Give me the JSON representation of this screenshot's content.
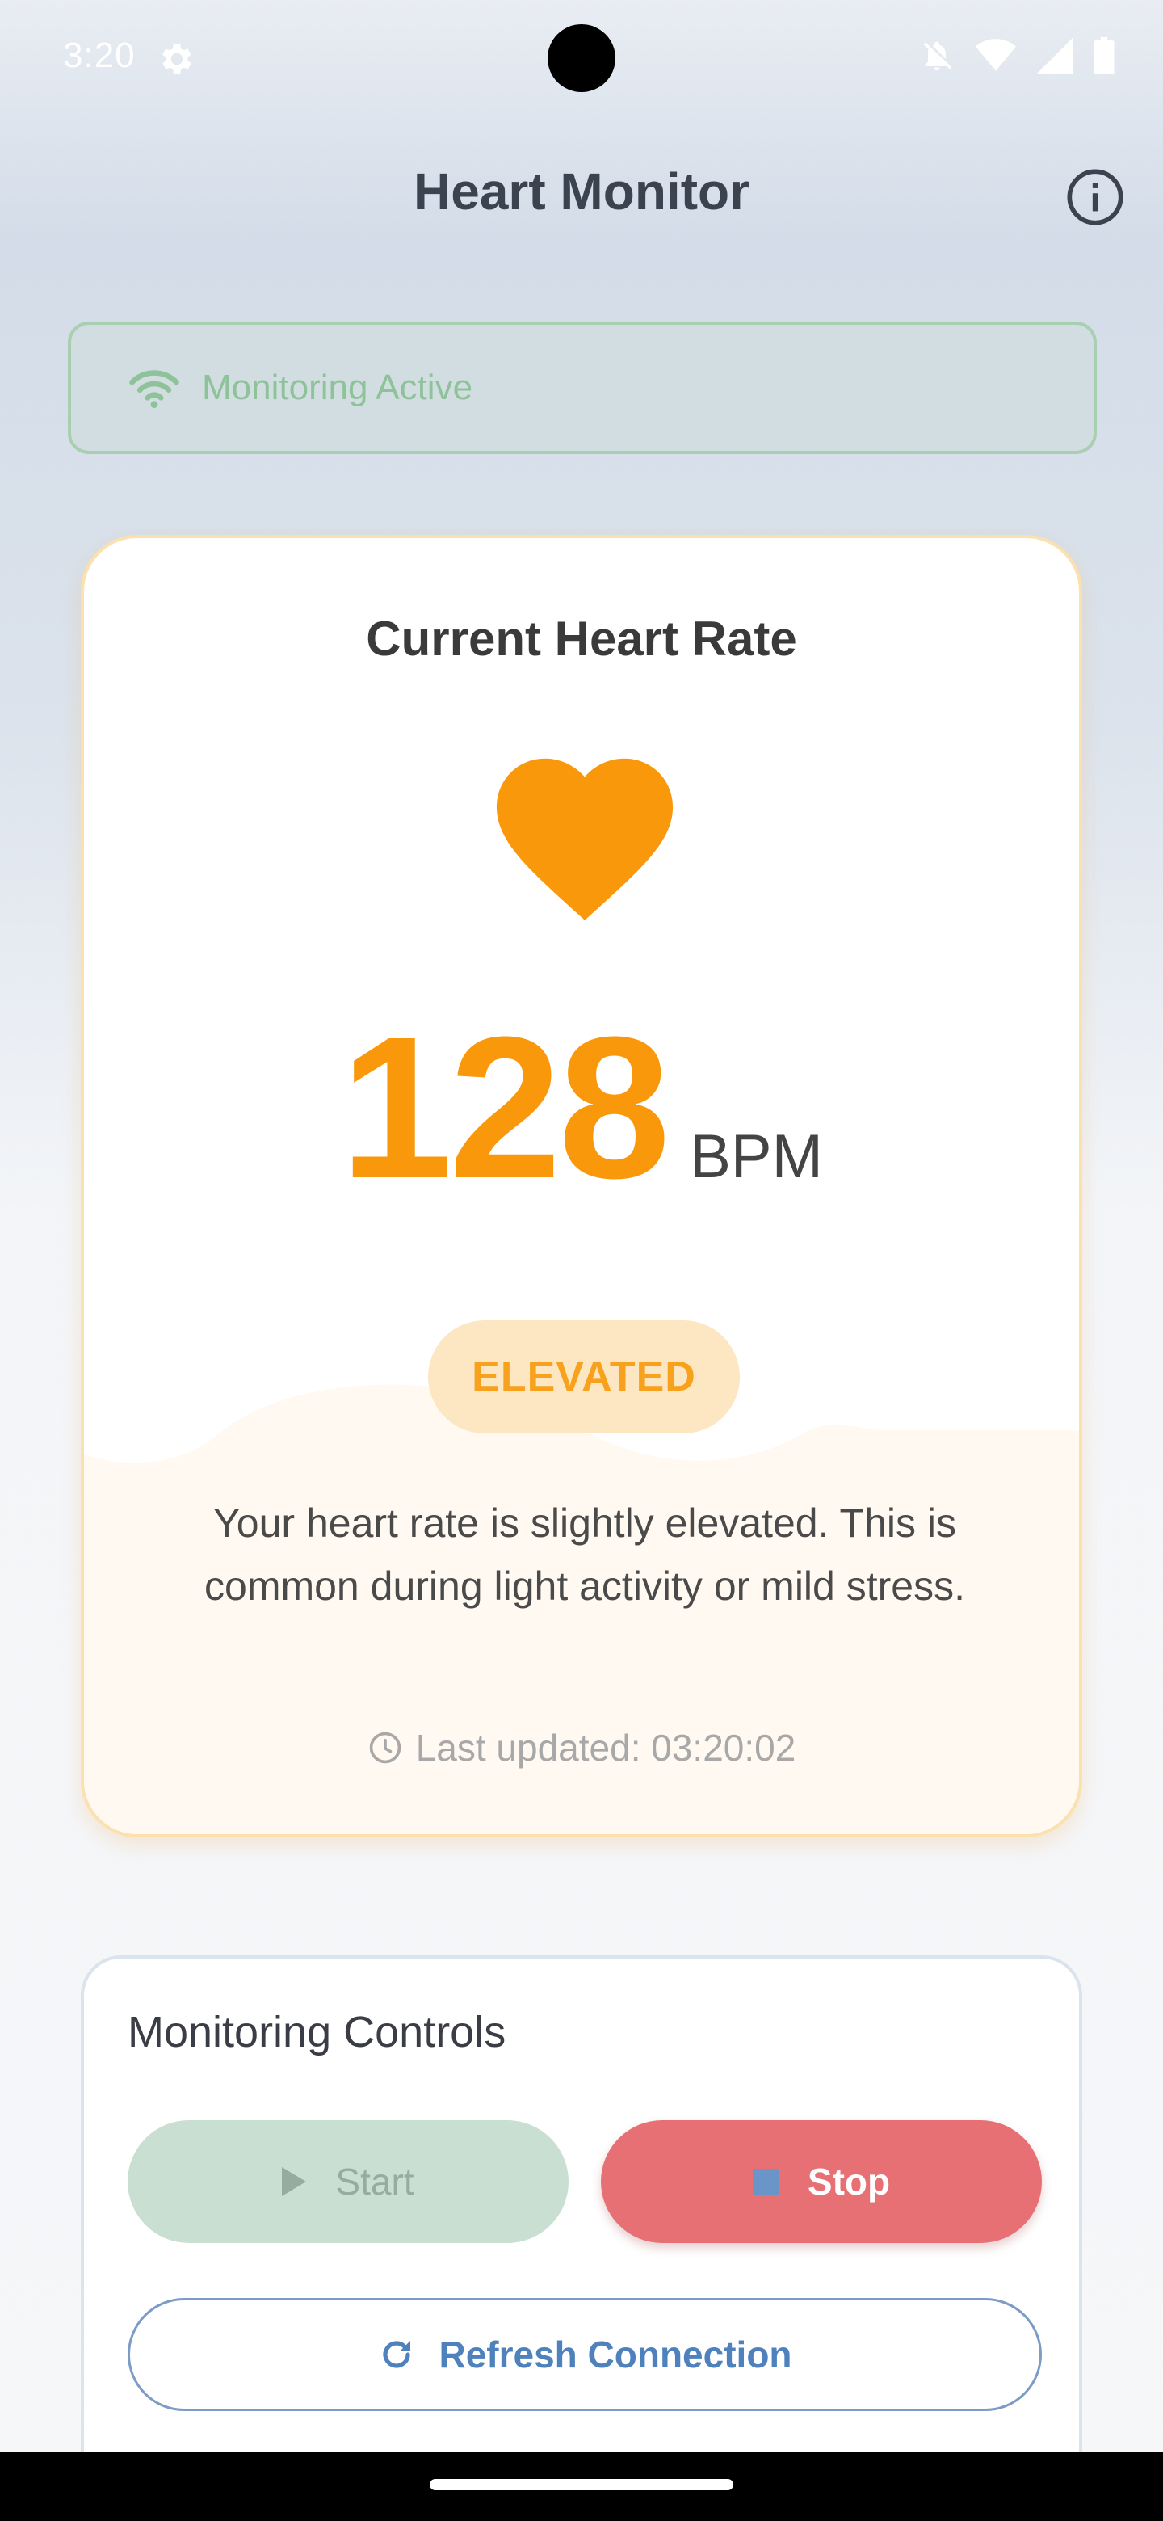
{
  "status_bar": {
    "time": "3:20",
    "icons": [
      "settings-icon",
      "notifications-off-icon",
      "wifi-icon",
      "signal-icon",
      "battery-icon"
    ]
  },
  "app_bar": {
    "title": "Heart Monitor",
    "info_icon": "info-icon"
  },
  "connection_banner": {
    "icon": "wifi-icon",
    "text": "Monitoring Active",
    "color": "#8ec39a"
  },
  "heart_rate_card": {
    "title": "Current Heart Rate",
    "icon": "heart-icon",
    "bpm_value": "128",
    "bpm_unit": "BPM",
    "status": "ELEVATED",
    "description": "Your heart rate is slightly elevated. This is common during light activity or mild stress.",
    "last_updated": "Last updated: 03:20:02",
    "accent_color": "#fa980c"
  },
  "controls": {
    "title": "Monitoring Controls",
    "start_label": "Start",
    "stop_label": "Stop",
    "refresh_label": "Refresh Connection",
    "stop_color": "#e67073",
    "refresh_color": "#4f82bd"
  }
}
